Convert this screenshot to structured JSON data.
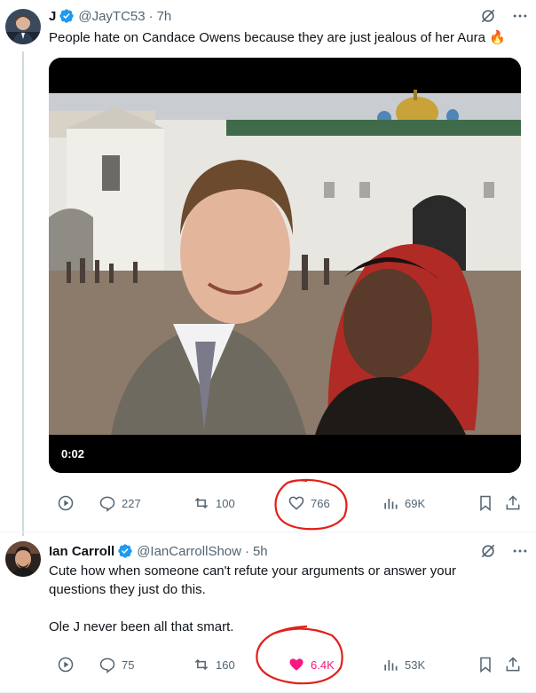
{
  "tweet1": {
    "name": "J",
    "handle": "@JayTC53",
    "separator": "·",
    "time": "7h",
    "text": "People hate on Candace Owens because they are just jealous of her Aura 🔥",
    "video_timestamp": "0:02",
    "actions": {
      "replies": "227",
      "reposts": "100",
      "likes": "766",
      "views": "69K"
    }
  },
  "tweet2": {
    "name": "Ian Carroll",
    "handle": "@IanCarrollShow",
    "separator": "·",
    "time": "5h",
    "text_line1": "Cute how when someone can't refute your arguments or answer your",
    "text_line2": "questions they just do this.",
    "text_line3": "Ole J never been all that smart.",
    "actions": {
      "replies": "75",
      "reposts": "160",
      "likes": "6.4K",
      "views": "53K"
    }
  },
  "colors": {
    "verified": "#1d9bf0",
    "muted": "#536471",
    "like_active": "#f91880",
    "annotation": "#e0201a"
  }
}
